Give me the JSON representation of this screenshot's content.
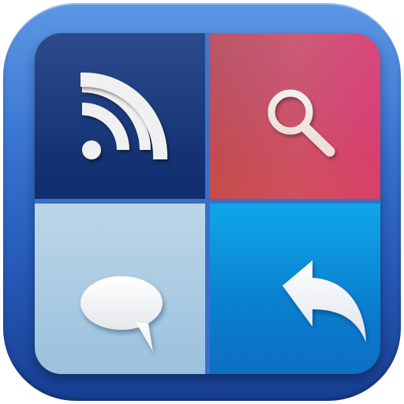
{
  "app": {
    "icons": {
      "top_left": "rss-feed-icon",
      "top_right": "search-magnifier-icon",
      "bottom_left": "chat-bubble-icon",
      "bottom_right": "reply-arrow-icon"
    },
    "colors": {
      "frame": "#3b78d4",
      "rss_tile": "#112e6d",
      "search_tile": "#c8506e",
      "chat_tile": "#a9cbe3",
      "reply_tile": "#0a8ad8",
      "glyph": "#f2f2f2"
    }
  }
}
